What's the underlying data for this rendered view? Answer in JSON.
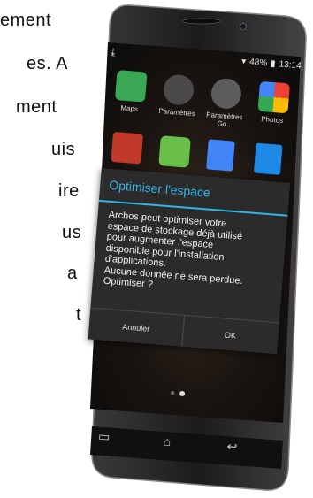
{
  "document": {
    "lines": [
      "ement",
      "es. A",
      "ment",
      "uis",
      "ire",
      "us",
      "a",
      "t"
    ]
  },
  "status_bar": {
    "download_icon": "download-icon",
    "battery": "48%",
    "time": "13:14"
  },
  "apps": [
    {
      "label": "Maps",
      "icon": "maps-icon",
      "color": "#3aa757"
    },
    {
      "label": "Paramètres",
      "icon": "settings-gear-icon",
      "color": "#5a5a5a"
    },
    {
      "label": "Paramètres Go..",
      "icon": "google-settings-icon",
      "color": "#6a6a6a"
    },
    {
      "label": "Photos",
      "icon": "photos-pinwheel-icon",
      "color": "#ea4335"
    }
  ],
  "dialog": {
    "title": "Optimiser l'espace",
    "body": "Archos peut optimiser votre\nespace de stockage déjà utilisé\npour augmenter l'espace\ndisponible pour l'installation\nd'applications.\nAucune donnée ne sera perdue.\nOptimiser ?",
    "cancel_label": "Annuler",
    "ok_label": "OK",
    "accent_color": "#33b5e5"
  },
  "nav_bar": {
    "recent_icon": "recent-apps-icon",
    "home_icon": "home-icon",
    "back_icon": "back-icon"
  }
}
